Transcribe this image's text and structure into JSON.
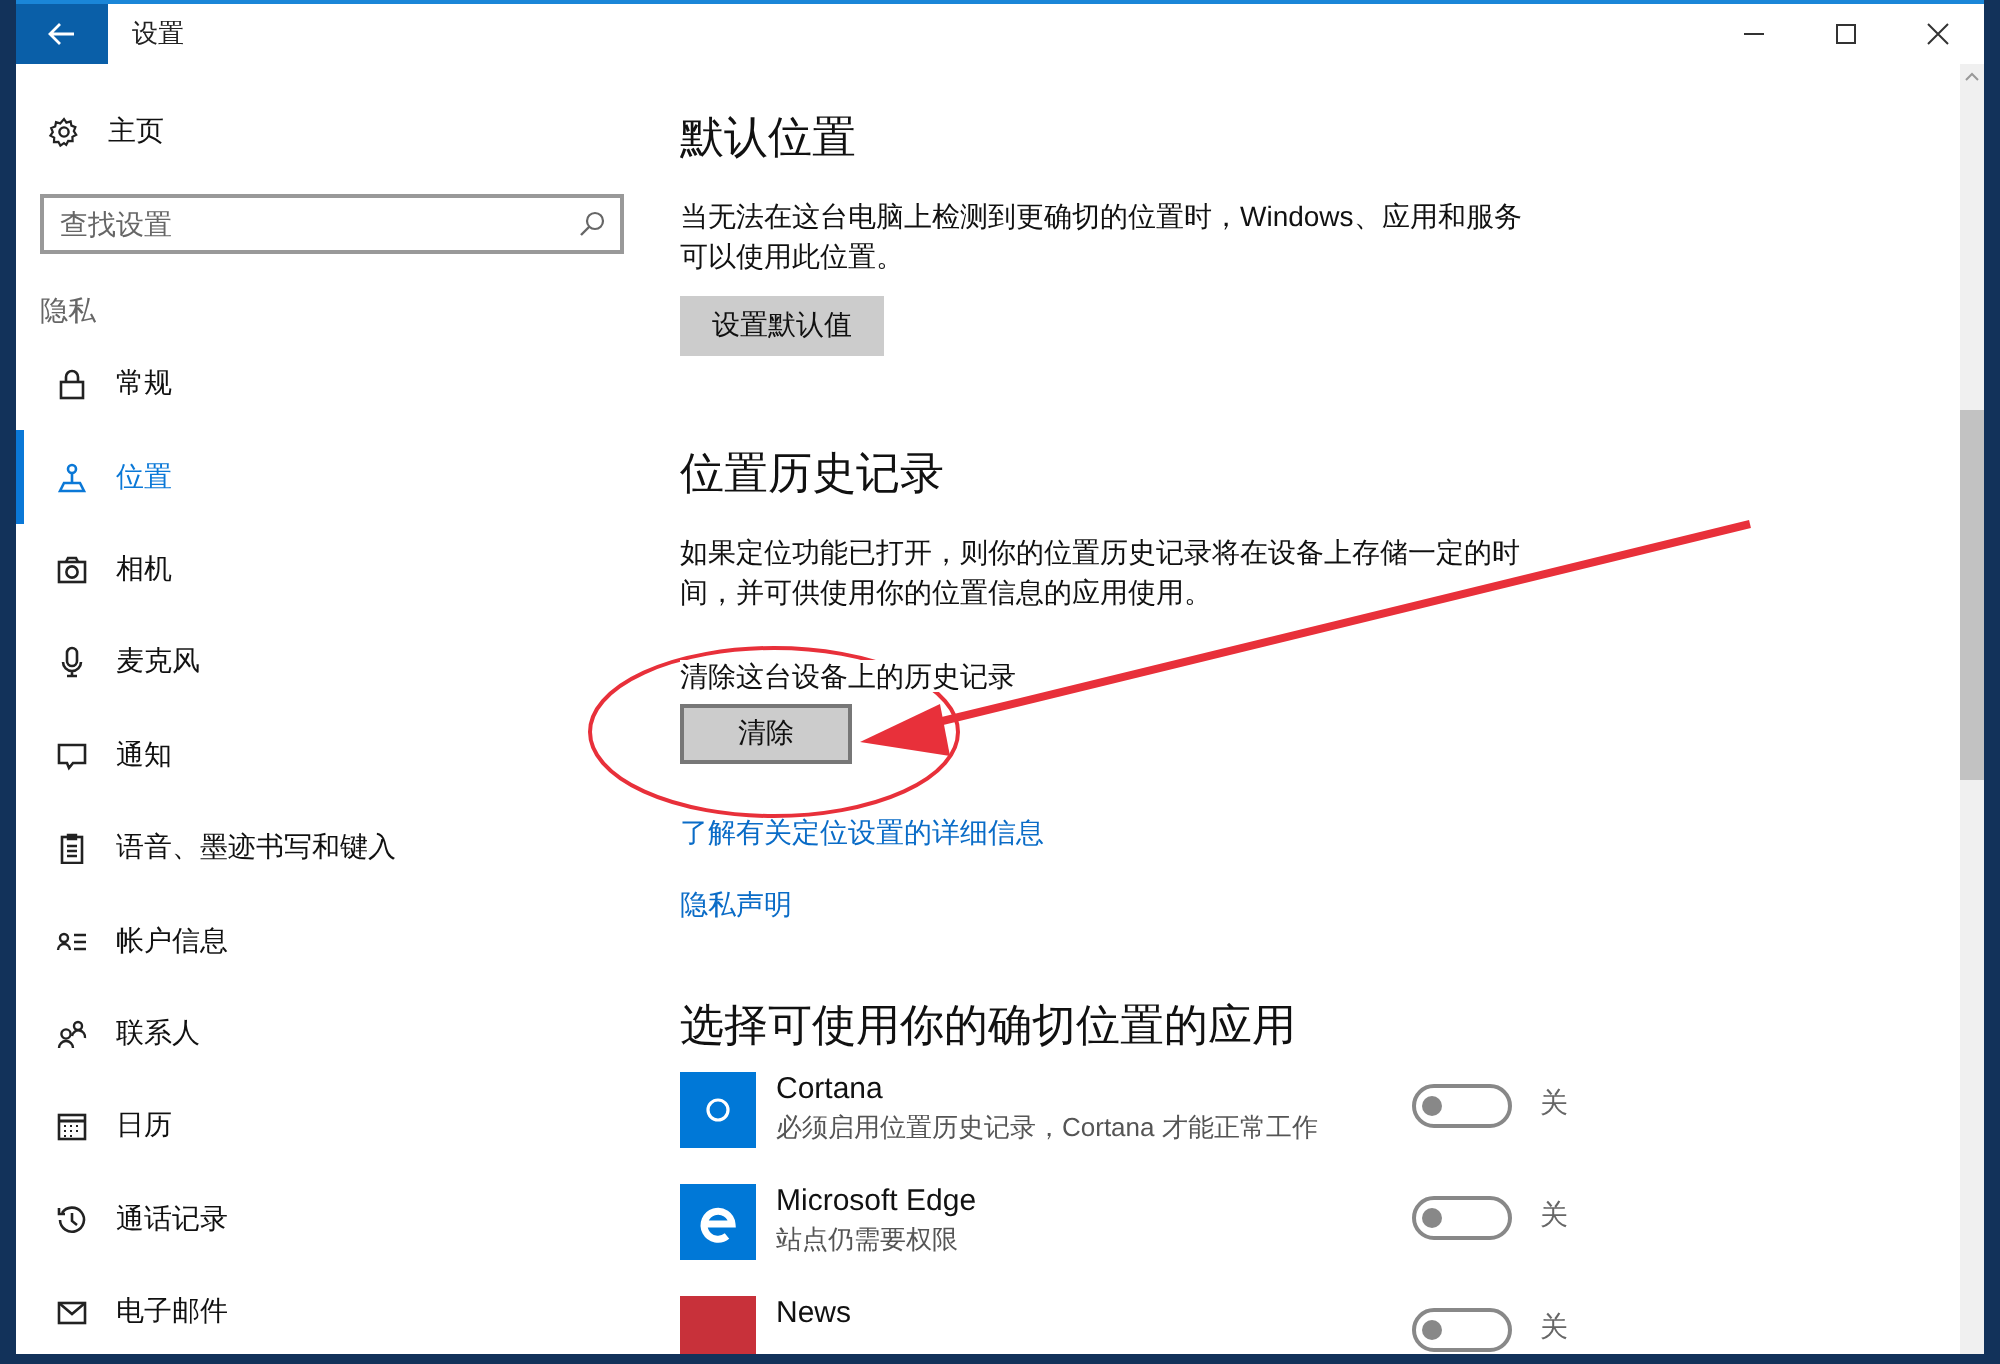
{
  "window": {
    "title": "设置"
  },
  "sidebar": {
    "home": "主页",
    "search": {
      "placeholder": "查找设置"
    },
    "section": "隐私",
    "items": [
      {
        "label": "常规",
        "selected": false
      },
      {
        "label": "位置",
        "selected": true
      },
      {
        "label": "相机",
        "selected": false
      },
      {
        "label": "麦克风",
        "selected": false
      },
      {
        "label": "通知",
        "selected": false
      },
      {
        "label": "语音、墨迹书写和键入",
        "selected": false
      },
      {
        "label": "帐户信息",
        "selected": false
      },
      {
        "label": "联系人",
        "selected": false
      },
      {
        "label": "日历",
        "selected": false
      },
      {
        "label": "通话记录",
        "selected": false
      },
      {
        "label": "电子邮件",
        "selected": false
      }
    ]
  },
  "default_location": {
    "heading": "默认位置",
    "description": "当无法在这台电脑上检测到更确切的位置时，Windows、应用和服务可以使用此位置。",
    "button": "设置默认值"
  },
  "location_history": {
    "heading": "位置历史记录",
    "description": "如果定位功能已打开，则你的位置历史记录将在设备上存储一定的时间，并可供使用你的位置信息的应用使用。",
    "clear_label": "清除这台设备上的历史记录",
    "clear_button": "清除"
  },
  "links": [
    "了解有关定位设置的详细信息",
    "隐私声明"
  ],
  "apps": {
    "heading": "选择可使用你的确切位置的应用",
    "items": [
      {
        "name": "Cortana",
        "description": "必须启用位置历史记录，Cortana 才能正常工作",
        "color": "#0078d7",
        "on": false,
        "state_label": "关"
      },
      {
        "name": "Microsoft Edge",
        "description": "站点仍需要权限",
        "color": "#0078d7",
        "on": false,
        "state_label": "关"
      },
      {
        "name": "News",
        "color": "#c8313a",
        "on": false,
        "state_label": "关"
      }
    ]
  }
}
